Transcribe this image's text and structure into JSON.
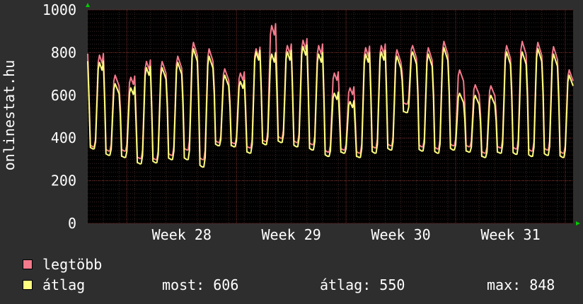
{
  "chart_data": {
    "type": "line",
    "ylabel": "onlinestat.hu",
    "yticks": [
      "0",
      "200",
      "400",
      "600",
      "800",
      "1000"
    ],
    "ylim": [
      0,
      1000
    ],
    "xlabel_ticks": [
      "Week 28",
      "Week 29",
      "Week 30",
      "Week 31"
    ],
    "grid": true,
    "days": 31,
    "series": [
      {
        "name": "legtöbb",
        "color": "#f47a8c",
        "peaks": [
          795,
          700,
          690,
          765,
          765,
          790,
          855,
          825,
          730,
          710,
          825,
          935,
          840,
          865,
          840,
          710,
          640,
          830,
          840,
          820,
          840,
          830,
          860,
          725,
          655,
          650,
          840,
          860,
          855,
          835,
          725,
          645
        ],
        "troughs": [
          360,
          340,
          340,
          305,
          300,
          320,
          345,
          300,
          380,
          375,
          355,
          385,
          400,
          380,
          370,
          335,
          345,
          330,
          355,
          365,
          560,
          360,
          350,
          365,
          360,
          330,
          355,
          350,
          340,
          345,
          330
        ]
      },
      {
        "name": "átlag",
        "color": "#ffff7f",
        "peaks": [
          760,
          660,
          640,
          735,
          735,
          760,
          825,
          790,
          700,
          670,
          810,
          800,
          810,
          835,
          800,
          615,
          575,
          800,
          810,
          790,
          810,
          800,
          830,
          615,
          605,
          605,
          810,
          810,
          825,
          800,
          700,
          605
        ],
        "troughs": [
          350,
          320,
          310,
          280,
          285,
          300,
          300,
          265,
          365,
          360,
          330,
          370,
          380,
          360,
          345,
          315,
          330,
          310,
          330,
          345,
          520,
          340,
          330,
          345,
          335,
          310,
          330,
          325,
          315,
          320,
          310
        ]
      }
    ]
  },
  "legend": {
    "max_label": "legtöbb",
    "avg_label": "átlag",
    "now_text": "most: 606",
    "avg_text": "átlag: 550",
    "max_text": "max: 848"
  }
}
